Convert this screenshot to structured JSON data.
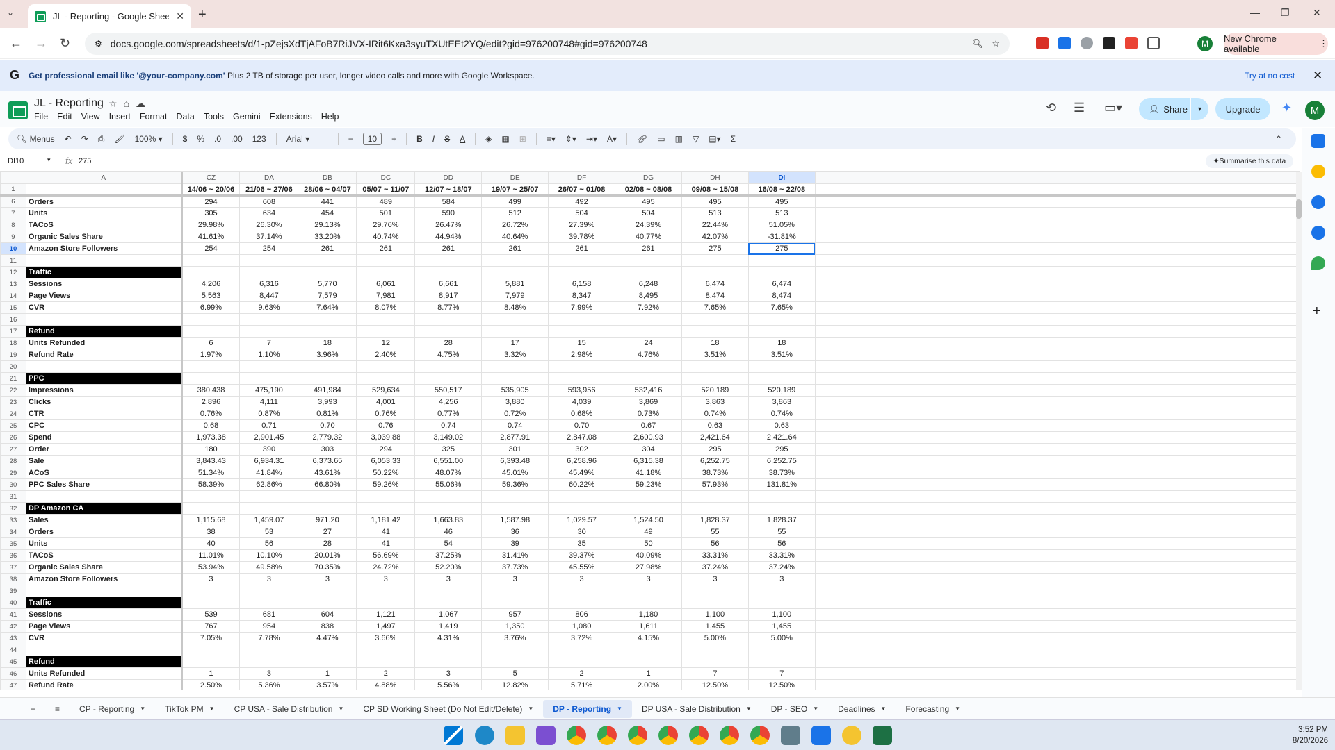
{
  "browser": {
    "tab_title": "JL - Reporting - Google Sheets",
    "url": "docs.google.com/spreadsheets/d/1-pZejsXdTjAFoB7RiJVX-IRit6Kxa3syuTXUtEEt2YQ/edit?gid=976200748#gid=976200748",
    "new_chrome": "New Chrome available",
    "profile_initial": "M"
  },
  "banner": {
    "bold": "Get professional email like '@your-company.com'",
    "rest": " Plus 2 TB of storage per user, longer video calls and more with Google Workspace.",
    "action": "Try at no cost"
  },
  "app": {
    "title": "JL - Reporting",
    "menus": [
      "File",
      "Edit",
      "View",
      "Insert",
      "Format",
      "Data",
      "Tools",
      "Gemini",
      "Extensions",
      "Help"
    ],
    "share": "Share",
    "upgrade": "Upgrade",
    "account_initial": "M"
  },
  "toolbar": {
    "menus": "Menus",
    "zoom": "100%",
    "currency": "$",
    "percent": "%",
    "dec_dec": ".0",
    "dec_inc": ".00",
    "format123": "123",
    "font": "Arial",
    "font_size": "10"
  },
  "formula_bar": {
    "name_box": "DI10",
    "fx": "fx",
    "value": "275",
    "summarise": "Summarise this data"
  },
  "grid": {
    "columns": [
      "A",
      "CZ",
      "DA",
      "DB",
      "DC",
      "DD",
      "DE",
      "DF",
      "DG",
      "DH",
      "DI"
    ],
    "selected_column": "DI",
    "rows": [
      {
        "n": "1",
        "label": "",
        "type": "hdr",
        "v": [
          "14/06 ~ 20/06",
          "21/06 ~ 27/06",
          "28/06 ~ 04/07",
          "05/07 ~ 11/07",
          "12/07 ~ 18/07",
          "19/07 ~ 25/07",
          "26/07 ~ 01/08",
          "02/08 ~ 08/08",
          "09/08 ~ 15/08",
          "16/08 ~ 22/08"
        ]
      },
      {
        "n": "6",
        "label": "Orders",
        "type": "data",
        "v": [
          "294",
          "608",
          "441",
          "489",
          "584",
          "499",
          "492",
          "495",
          "495",
          "495"
        ]
      },
      {
        "n": "7",
        "label": "Units",
        "type": "data",
        "v": [
          "305",
          "634",
          "454",
          "501",
          "590",
          "512",
          "504",
          "504",
          "513",
          "513"
        ]
      },
      {
        "n": "8",
        "label": "TACoS",
        "type": "data",
        "v": [
          "29.98%",
          "26.30%",
          "29.13%",
          "29.76%",
          "26.47%",
          "26.72%",
          "27.39%",
          "24.39%",
          "22.44%",
          "51.05%"
        ]
      },
      {
        "n": "9",
        "label": "Organic Sales Share",
        "type": "data",
        "v": [
          "41.61%",
          "37.14%",
          "33.20%",
          "40.74%",
          "44.94%",
          "40.64%",
          "39.78%",
          "40.77%",
          "42.07%",
          "-31.81%"
        ]
      },
      {
        "n": "10",
        "label": "Amazon Store Followers",
        "type": "data",
        "v": [
          "254",
          "254",
          "261",
          "261",
          "261",
          "261",
          "261",
          "261",
          "275",
          "275"
        ]
      },
      {
        "n": "11",
        "label": "",
        "type": "empty",
        "v": []
      },
      {
        "n": "12",
        "label": "Traffic",
        "type": "sec",
        "v": []
      },
      {
        "n": "13",
        "label": "Sessions",
        "type": "data",
        "v": [
          "4,206",
          "6,316",
          "5,770",
          "6,061",
          "6,661",
          "5,881",
          "6,158",
          "6,248",
          "6,474",
          "6,474"
        ]
      },
      {
        "n": "14",
        "label": "Page Views",
        "type": "data",
        "v": [
          "5,563",
          "8,447",
          "7,579",
          "7,981",
          "8,917",
          "7,979",
          "8,347",
          "8,495",
          "8,474",
          "8,474"
        ]
      },
      {
        "n": "15",
        "label": "CVR",
        "type": "data",
        "v": [
          "6.99%",
          "9.63%",
          "7.64%",
          "8.07%",
          "8.77%",
          "8.48%",
          "7.99%",
          "7.92%",
          "7.65%",
          "7.65%"
        ]
      },
      {
        "n": "16",
        "label": "",
        "type": "empty",
        "v": []
      },
      {
        "n": "17",
        "label": "Refund",
        "type": "sec",
        "v": []
      },
      {
        "n": "18",
        "label": "Units Refunded",
        "type": "data",
        "v": [
          "6",
          "7",
          "18",
          "12",
          "28",
          "17",
          "15",
          "24",
          "18",
          "18"
        ]
      },
      {
        "n": "19",
        "label": "Refund Rate",
        "type": "data",
        "v": [
          "1.97%",
          "1.10%",
          "3.96%",
          "2.40%",
          "4.75%",
          "3.32%",
          "2.98%",
          "4.76%",
          "3.51%",
          "3.51%"
        ]
      },
      {
        "n": "20",
        "label": "",
        "type": "empty",
        "v": []
      },
      {
        "n": "21",
        "label": "PPC",
        "type": "sec",
        "v": []
      },
      {
        "n": "22",
        "label": "Impressions",
        "type": "data",
        "v": [
          "380,438",
          "475,190",
          "491,984",
          "529,634",
          "550,517",
          "535,905",
          "593,956",
          "532,416",
          "520,189",
          "520,189"
        ]
      },
      {
        "n": "23",
        "label": "Clicks",
        "type": "data",
        "v": [
          "2,896",
          "4,111",
          "3,993",
          "4,001",
          "4,256",
          "3,880",
          "4,039",
          "3,869",
          "3,863",
          "3,863"
        ]
      },
      {
        "n": "24",
        "label": "CTR",
        "type": "data",
        "v": [
          "0.76%",
          "0.87%",
          "0.81%",
          "0.76%",
          "0.77%",
          "0.72%",
          "0.68%",
          "0.73%",
          "0.74%",
          "0.74%"
        ]
      },
      {
        "n": "25",
        "label": "CPC",
        "type": "data",
        "v": [
          "0.68",
          "0.71",
          "0.70",
          "0.76",
          "0.74",
          "0.74",
          "0.70",
          "0.67",
          "0.63",
          "0.63"
        ]
      },
      {
        "n": "26",
        "label": "Spend",
        "type": "data",
        "v": [
          "1,973.38",
          "2,901.45",
          "2,779.32",
          "3,039.88",
          "3,149.02",
          "2,877.91",
          "2,847.08",
          "2,600.93",
          "2,421.64",
          "2,421.64"
        ]
      },
      {
        "n": "27",
        "label": "Order",
        "type": "data",
        "v": [
          "180",
          "390",
          "303",
          "294",
          "325",
          "301",
          "302",
          "304",
          "295",
          "295"
        ]
      },
      {
        "n": "28",
        "label": "Sale",
        "type": "data",
        "v": [
          "3,843.43",
          "6,934.31",
          "6,373.65",
          "6,053.33",
          "6,551.00",
          "6,393.48",
          "6,258.96",
          "6,315.38",
          "6,252.75",
          "6,252.75"
        ]
      },
      {
        "n": "29",
        "label": "ACoS",
        "type": "data",
        "v": [
          "51.34%",
          "41.84%",
          "43.61%",
          "50.22%",
          "48.07%",
          "45.01%",
          "45.49%",
          "41.18%",
          "38.73%",
          "38.73%"
        ]
      },
      {
        "n": "30",
        "label": "PPC Sales Share",
        "type": "data",
        "v": [
          "58.39%",
          "62.86%",
          "66.80%",
          "59.26%",
          "55.06%",
          "59.36%",
          "60.22%",
          "59.23%",
          "57.93%",
          "131.81%"
        ]
      },
      {
        "n": "31",
        "label": "",
        "type": "empty",
        "v": []
      },
      {
        "n": "32",
        "label": "DP Amazon CA",
        "type": "sec",
        "v": []
      },
      {
        "n": "33",
        "label": "Sales",
        "type": "data",
        "v": [
          "1,115.68",
          "1,459.07",
          "971.20",
          "1,181.42",
          "1,663.83",
          "1,587.98",
          "1,029.57",
          "1,524.50",
          "1,828.37",
          "1,828.37"
        ]
      },
      {
        "n": "34",
        "label": "Orders",
        "type": "data",
        "v": [
          "38",
          "53",
          "27",
          "41",
          "46",
          "36",
          "30",
          "49",
          "55",
          "55"
        ]
      },
      {
        "n": "35",
        "label": "Units",
        "type": "data",
        "v": [
          "40",
          "56",
          "28",
          "41",
          "54",
          "39",
          "35",
          "50",
          "56",
          "56"
        ]
      },
      {
        "n": "36",
        "label": "TACoS",
        "type": "data",
        "v": [
          "11.01%",
          "10.10%",
          "20.01%",
          "56.69%",
          "37.25%",
          "31.41%",
          "39.37%",
          "40.09%",
          "33.31%",
          "33.31%"
        ]
      },
      {
        "n": "37",
        "label": "Organic Sales Share",
        "type": "data",
        "v": [
          "53.94%",
          "49.58%",
          "70.35%",
          "24.72%",
          "52.20%",
          "37.73%",
          "45.55%",
          "27.98%",
          "37.24%",
          "37.24%"
        ]
      },
      {
        "n": "38",
        "label": "Amazon Store Followers",
        "type": "data",
        "v": [
          "3",
          "3",
          "3",
          "3",
          "3",
          "3",
          "3",
          "3",
          "3",
          "3"
        ]
      },
      {
        "n": "39",
        "label": "",
        "type": "empty",
        "v": []
      },
      {
        "n": "40",
        "label": "Traffic",
        "type": "sec",
        "v": []
      },
      {
        "n": "41",
        "label": "Sessions",
        "type": "data",
        "v": [
          "539",
          "681",
          "604",
          "1,121",
          "1,067",
          "957",
          "806",
          "1,180",
          "1,100",
          "1,100"
        ]
      },
      {
        "n": "42",
        "label": "Page Views",
        "type": "data",
        "v": [
          "767",
          "954",
          "838",
          "1,497",
          "1,419",
          "1,350",
          "1,080",
          "1,611",
          "1,455",
          "1,455"
        ]
      },
      {
        "n": "43",
        "label": "CVR",
        "type": "data",
        "v": [
          "7.05%",
          "7.78%",
          "4.47%",
          "3.66%",
          "4.31%",
          "3.76%",
          "3.72%",
          "4.15%",
          "5.00%",
          "5.00%"
        ]
      },
      {
        "n": "44",
        "label": "",
        "type": "empty",
        "v": []
      },
      {
        "n": "45",
        "label": "Refund",
        "type": "sec",
        "v": []
      },
      {
        "n": "46",
        "label": "Units Refunded",
        "type": "data",
        "v": [
          "1",
          "3",
          "1",
          "2",
          "3",
          "5",
          "2",
          "1",
          "7",
          "7"
        ]
      },
      {
        "n": "47",
        "label": "Refund Rate",
        "type": "data",
        "v": [
          "2.50%",
          "5.36%",
          "3.57%",
          "4.88%",
          "5.56%",
          "12.82%",
          "5.71%",
          "2.00%",
          "12.50%",
          "12.50%"
        ]
      }
    ]
  },
  "sheet_tabs": [
    {
      "label": "CP - Reporting",
      "active": false
    },
    {
      "label": "TikTok PM",
      "active": false
    },
    {
      "label": "CP USA - Sale Distribution",
      "active": false
    },
    {
      "label": "CP SD Working Sheet (Do Not Edit/Delete)",
      "active": false
    },
    {
      "label": "DP - Reporting",
      "active": true
    },
    {
      "label": "DP USA - Sale Distribution",
      "active": false
    },
    {
      "label": "DP - SEO",
      "active": false
    },
    {
      "label": "Deadlines",
      "active": false
    },
    {
      "label": "Forecasting",
      "active": false
    }
  ],
  "clock": {
    "time": "3:52 PM",
    "date": "8/20/2026"
  },
  "colors": {
    "selection": "#1a73e8",
    "section_bg": "#000000",
    "share_bg": "#c2e7ff",
    "banner_bg": "#e3ecfb"
  }
}
